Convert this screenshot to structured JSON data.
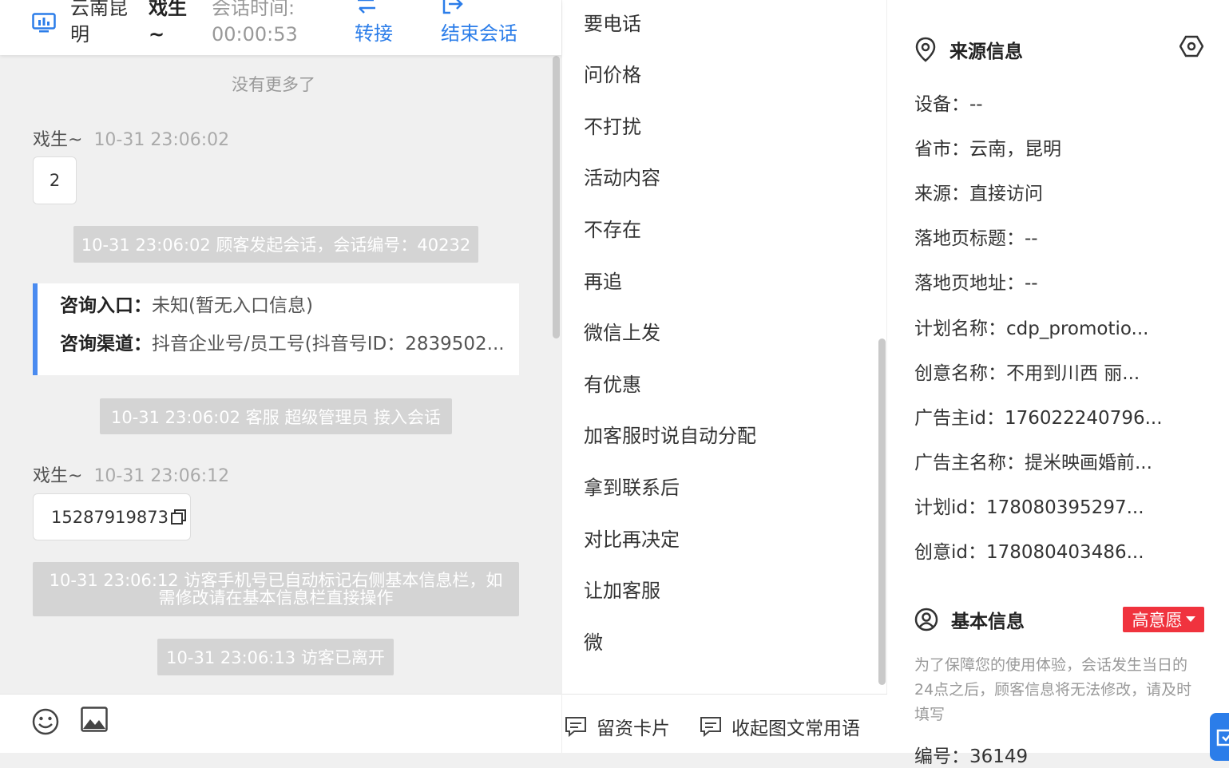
{
  "header": {
    "region": "云南昆明",
    "visitor_name": "戏生~",
    "session_time": "会话时间: 00:00:53",
    "transfer_label": "转接",
    "end_label": "结束会话"
  },
  "chat": {
    "no_more": "没有更多了",
    "msg1_sender": "戏生~",
    "msg1_time": "10-31 23:06:02",
    "msg1_text": "2",
    "sys1": "10-31 23:06:02 顾客发起会话，会话编号：40232",
    "consult_entry_label": "咨询入口：",
    "consult_entry_value": "未知(暂无入口信息)",
    "consult_channel_label": "咨询渠道：",
    "consult_channel_value": "抖音企业号/员工号(抖音号ID：2839502...",
    "sys2": "10-31 23:06:02 客服 超级管理员 接入会话",
    "msg2_sender": "戏生~",
    "msg2_time": "10-31 23:06:12",
    "msg2_text": "15287919873",
    "sys3": "10-31 23:06:12 访客手机号已自动标记右侧基本信息栏，如需修改请在基本信息栏直接操作",
    "sys4": "10-31 23:06:13 访客已离开"
  },
  "chat_footer": {
    "emoji_icon": "smile-icon",
    "image_icon": "image-icon"
  },
  "phrases": {
    "items": [
      "要电话",
      "问价格",
      "不打扰",
      "活动内容",
      "不存在",
      "再追",
      "微信上发",
      "有优惠",
      "加客服时说自动分配",
      "拿到联系后",
      "对比再决定",
      "让加客服",
      "微"
    ],
    "card_label": "留资卡片",
    "collapse_label": "收起图文常用语"
  },
  "source_info": {
    "title": "来源信息",
    "rows": [
      "设备：--",
      "省市：云南，昆明",
      "来源：直接访问",
      "落地页标题：--",
      "落地页地址：--",
      "计划名称：cdp_promotio...",
      "创意名称：不用到川西 丽...",
      "广告主id：176022240796...",
      "广告主名称：提米映画婚前...",
      "计划id：178080395297...",
      "创意id：178080403486..."
    ]
  },
  "basic_info": {
    "title": "基本信息",
    "intent_badge": "高意愿",
    "notice": "为了保障您的使用体验，会话发生当日的24点之后，顾客信息将无法修改，请及时填写",
    "id_row": "编号：36149"
  },
  "colors": {
    "accent": "#2b7de9",
    "badge": "#f0333e",
    "system_note": "#d4d4d4"
  }
}
